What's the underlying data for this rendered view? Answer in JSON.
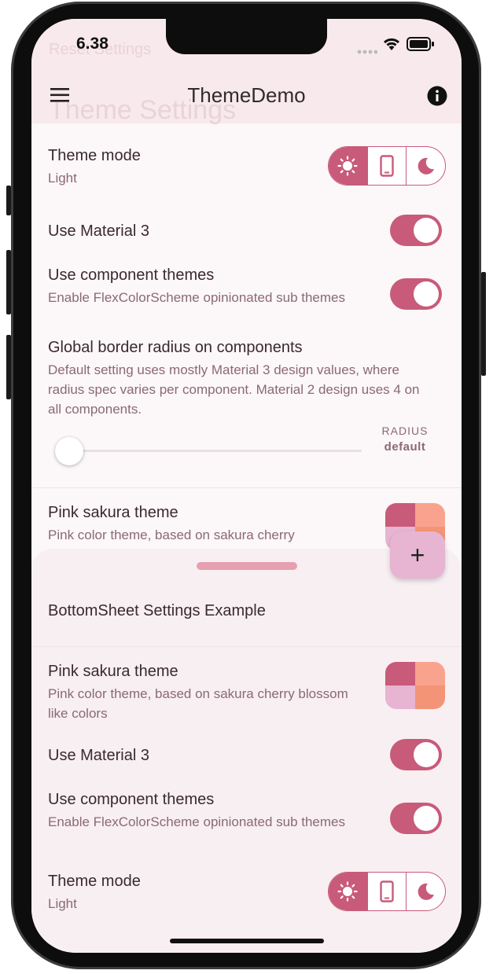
{
  "status": {
    "time": "6.38"
  },
  "appbar": {
    "title": "ThemeDemo",
    "ghost_small": "Reset Settings",
    "ghost_large": "Theme Settings"
  },
  "main": {
    "theme_mode": {
      "label": "Theme mode",
      "value": "Light"
    },
    "material3": {
      "label": "Use Material 3",
      "on": true
    },
    "component_themes": {
      "label": "Use component themes",
      "description": "Enable FlexColorScheme opinionated sub themes",
      "on": true
    },
    "border_radius": {
      "label": "Global border radius on components",
      "description": "Default setting uses mostly Material 3 design values, where radius spec varies per component. Material 2 design uses 4 on all components.",
      "value_caption": "RADIUS",
      "value": "default",
      "slider_fraction": 0
    },
    "pink_sakura": {
      "label": "Pink sakura theme",
      "description": "Pink color theme, based on sakura cherry"
    }
  },
  "sheet": {
    "title": "BottomSheet Settings Example",
    "pink_sakura": {
      "label": "Pink sakura theme",
      "description": "Pink color theme, based on sakura cherry blossom like colors"
    },
    "material3": {
      "label": "Use Material 3",
      "on": true
    },
    "component_themes": {
      "label": "Use component themes",
      "description": "Enable FlexColorScheme opinionated sub themes",
      "on": true
    },
    "theme_mode": {
      "label": "Theme mode",
      "value": "Light"
    }
  },
  "fab": {
    "icon": "plus-icon",
    "label": "+"
  },
  "icons": {
    "menu": "menu-icon",
    "info": "info-icon",
    "light": "sun-icon",
    "system": "phone-icon",
    "dark": "moon-icon"
  },
  "colors": {
    "primary": "#c85a7a",
    "swatch": [
      "#c85a7a",
      "#f9a38e",
      "#e7b4d1",
      "#f49476"
    ],
    "fab": "#e7b4d1",
    "handle": "#e6a0b2"
  }
}
